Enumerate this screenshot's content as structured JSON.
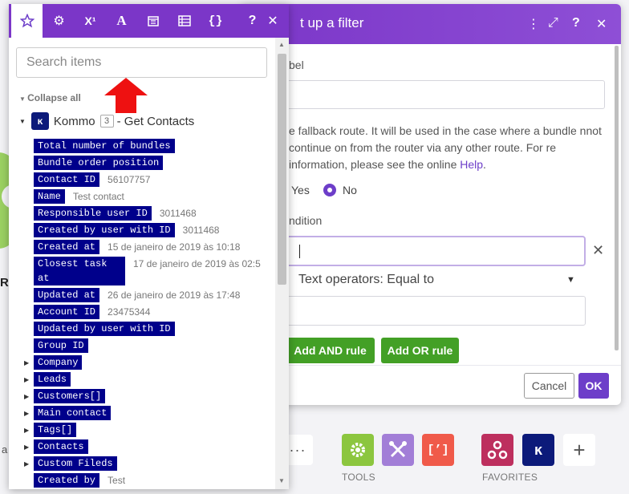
{
  "canvas": {
    "fragment_label": "R",
    "fragment_small": "a",
    "tools_label": "TOOLS",
    "favorites_label": "FAVORITES",
    "more_label": "···"
  },
  "dialog": {
    "title": "t up a filter",
    "label_field_label": "bel",
    "fallback_text": "e fallback route. It will be used in the case where a bundle nnot continue on from the router via any other route. For re information, please see the online",
    "help_link": "Help",
    "help_suffix": ".",
    "yes_label": "Yes",
    "no_label": "No",
    "condition_label": "ndition",
    "operator_value": "Text operators: Equal to",
    "add_and_label": "Add AND rule",
    "add_or_label": "Add OR rule",
    "cancel_label": "Cancel",
    "ok_label": "OK",
    "accent_color": "#6d3ec9"
  },
  "panel": {
    "tabs": [
      "star-icon",
      "gear-icon",
      "superscript-icon",
      "text-icon",
      "calendar-icon",
      "table-icon",
      "braces-icon",
      "help-icon",
      "close-icon"
    ],
    "search_placeholder": "Search items",
    "collapse_all": "Collapse all",
    "module": {
      "name": "Kommo",
      "badge": "3",
      "rest": "- Get Contacts",
      "icon": "kommo-icon"
    },
    "items": [
      {
        "label": "Total number of bundles",
        "value": ""
      },
      {
        "label": "Bundle order position",
        "value": ""
      },
      {
        "label": "Contact ID",
        "value": "56107757"
      },
      {
        "label": "Name",
        "value": "Test contact"
      },
      {
        "label": "Responsible user ID",
        "value": "3011468"
      },
      {
        "label": "Created by user with ID",
        "value": "3011468"
      },
      {
        "label": "Created at",
        "value": "15 de janeiro de 2019 às 10:18"
      },
      {
        "label": "Closest task at",
        "value": "17 de janeiro de 2019 às 02:5"
      },
      {
        "label": "Updated at",
        "value": "26 de janeiro de 2019 às 17:48"
      },
      {
        "label": "Account ID",
        "value": "23475344"
      },
      {
        "label": "Updated by user with ID",
        "value": ""
      },
      {
        "label": "Group ID",
        "value": ""
      },
      {
        "label": "Company",
        "value": ""
      },
      {
        "label": "Leads",
        "value": ""
      },
      {
        "label": "Customers[]",
        "value": ""
      },
      {
        "label": "Main contact",
        "value": ""
      },
      {
        "label": "Tags[]",
        "value": ""
      },
      {
        "label": "Contacts",
        "value": ""
      },
      {
        "label": "Custom Fileds",
        "value": ""
      },
      {
        "label": "Created by",
        "value": "Test"
      }
    ],
    "tag_color": "#00008b"
  }
}
